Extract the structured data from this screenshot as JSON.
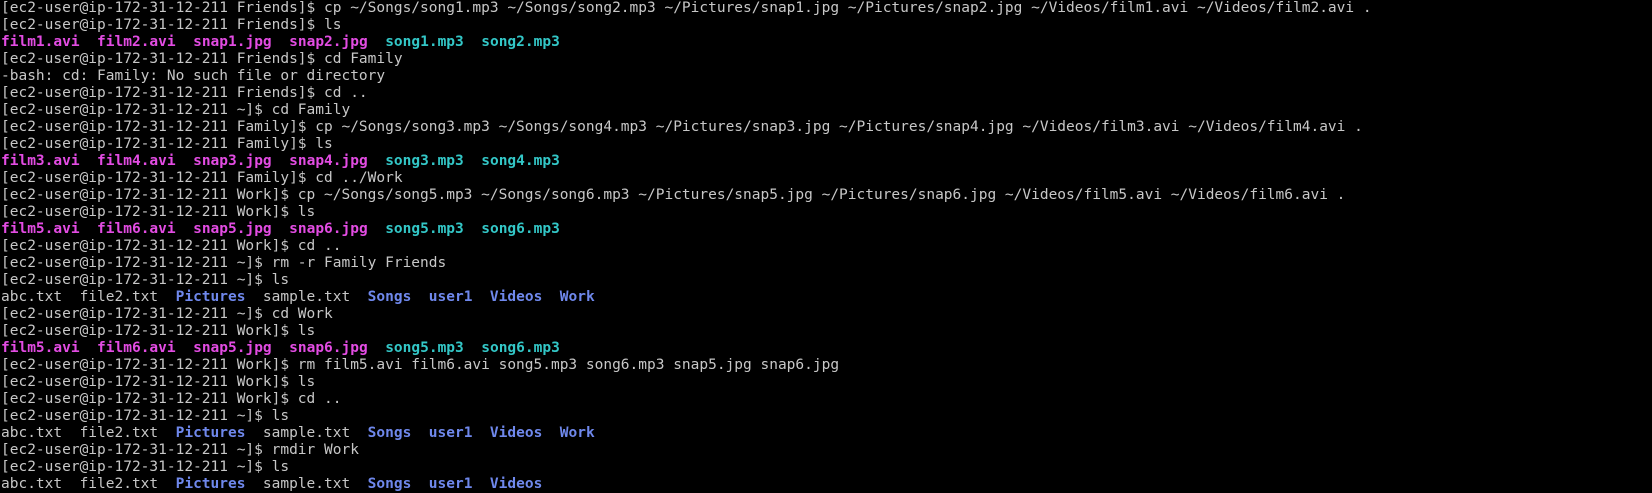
{
  "terminal": {
    "lines": [
      [
        {
          "t": "text",
          "v": "[ec2-user@ip-172-31-12-211 Friends]$ cp ~/Songs/song1.mp3 ~/Songs/song2.mp3 ~/Pictures/snap1.jpg ~/Pictures/snap2.jpg ~/Videos/film1.avi ~/Videos/film2.avi ."
        }
      ],
      [
        {
          "t": "text",
          "v": "[ec2-user@ip-172-31-12-211 Friends]$ ls"
        }
      ],
      [
        {
          "t": "media",
          "v": "film1.avi"
        },
        {
          "t": "text",
          "v": "  "
        },
        {
          "t": "media",
          "v": "film2.avi"
        },
        {
          "t": "text",
          "v": "  "
        },
        {
          "t": "media",
          "v": "snap1.jpg"
        },
        {
          "t": "text",
          "v": "  "
        },
        {
          "t": "media",
          "v": "snap2.jpg"
        },
        {
          "t": "text",
          "v": "  "
        },
        {
          "t": "audio",
          "v": "song1.mp3"
        },
        {
          "t": "text",
          "v": "  "
        },
        {
          "t": "audio",
          "v": "song2.mp3"
        }
      ],
      [
        {
          "t": "text",
          "v": "[ec2-user@ip-172-31-12-211 Friends]$ cd Family"
        }
      ],
      [
        {
          "t": "text",
          "v": "-bash: cd: Family: No such file or directory"
        }
      ],
      [
        {
          "t": "text",
          "v": "[ec2-user@ip-172-31-12-211 Friends]$ cd .."
        }
      ],
      [
        {
          "t": "text",
          "v": "[ec2-user@ip-172-31-12-211 ~]$ cd Family"
        }
      ],
      [
        {
          "t": "text",
          "v": "[ec2-user@ip-172-31-12-211 Family]$ cp ~/Songs/song3.mp3 ~/Songs/song4.mp3 ~/Pictures/snap3.jpg ~/Pictures/snap4.jpg ~/Videos/film3.avi ~/Videos/film4.avi ."
        }
      ],
      [
        {
          "t": "text",
          "v": "[ec2-user@ip-172-31-12-211 Family]$ ls"
        }
      ],
      [
        {
          "t": "media",
          "v": "film3.avi"
        },
        {
          "t": "text",
          "v": "  "
        },
        {
          "t": "media",
          "v": "film4.avi"
        },
        {
          "t": "text",
          "v": "  "
        },
        {
          "t": "media",
          "v": "snap3.jpg"
        },
        {
          "t": "text",
          "v": "  "
        },
        {
          "t": "media",
          "v": "snap4.jpg"
        },
        {
          "t": "text",
          "v": "  "
        },
        {
          "t": "audio",
          "v": "song3.mp3"
        },
        {
          "t": "text",
          "v": "  "
        },
        {
          "t": "audio",
          "v": "song4.mp3"
        }
      ],
      [
        {
          "t": "text",
          "v": "[ec2-user@ip-172-31-12-211 Family]$ cd ../Work"
        }
      ],
      [
        {
          "t": "text",
          "v": "[ec2-user@ip-172-31-12-211 Work]$ cp ~/Songs/song5.mp3 ~/Songs/song6.mp3 ~/Pictures/snap5.jpg ~/Pictures/snap6.jpg ~/Videos/film5.avi ~/Videos/film6.avi ."
        }
      ],
      [
        {
          "t": "text",
          "v": "[ec2-user@ip-172-31-12-211 Work]$ ls"
        }
      ],
      [
        {
          "t": "media",
          "v": "film5.avi"
        },
        {
          "t": "text",
          "v": "  "
        },
        {
          "t": "media",
          "v": "film6.avi"
        },
        {
          "t": "text",
          "v": "  "
        },
        {
          "t": "media",
          "v": "snap5.jpg"
        },
        {
          "t": "text",
          "v": "  "
        },
        {
          "t": "media",
          "v": "snap6.jpg"
        },
        {
          "t": "text",
          "v": "  "
        },
        {
          "t": "audio",
          "v": "song5.mp3"
        },
        {
          "t": "text",
          "v": "  "
        },
        {
          "t": "audio",
          "v": "song6.mp3"
        }
      ],
      [
        {
          "t": "text",
          "v": "[ec2-user@ip-172-31-12-211 Work]$ cd .."
        }
      ],
      [
        {
          "t": "text",
          "v": "[ec2-user@ip-172-31-12-211 ~]$ rm -r Family Friends"
        }
      ],
      [
        {
          "t": "text",
          "v": "[ec2-user@ip-172-31-12-211 ~]$ ls"
        }
      ],
      [
        {
          "t": "text",
          "v": "abc.txt  file2.txt  "
        },
        {
          "t": "dir",
          "v": "Pictures"
        },
        {
          "t": "text",
          "v": "  sample.txt  "
        },
        {
          "t": "dir",
          "v": "Songs"
        },
        {
          "t": "text",
          "v": "  "
        },
        {
          "t": "dir",
          "v": "user1"
        },
        {
          "t": "text",
          "v": "  "
        },
        {
          "t": "dir",
          "v": "Videos"
        },
        {
          "t": "text",
          "v": "  "
        },
        {
          "t": "dir",
          "v": "Work"
        }
      ],
      [
        {
          "t": "text",
          "v": "[ec2-user@ip-172-31-12-211 ~]$ cd Work"
        }
      ],
      [
        {
          "t": "text",
          "v": "[ec2-user@ip-172-31-12-211 Work]$ ls"
        }
      ],
      [
        {
          "t": "media",
          "v": "film5.avi"
        },
        {
          "t": "text",
          "v": "  "
        },
        {
          "t": "media",
          "v": "film6.avi"
        },
        {
          "t": "text",
          "v": "  "
        },
        {
          "t": "media",
          "v": "snap5.jpg"
        },
        {
          "t": "text",
          "v": "  "
        },
        {
          "t": "media",
          "v": "snap6.jpg"
        },
        {
          "t": "text",
          "v": "  "
        },
        {
          "t": "audio",
          "v": "song5.mp3"
        },
        {
          "t": "text",
          "v": "  "
        },
        {
          "t": "audio",
          "v": "song6.mp3"
        }
      ],
      [
        {
          "t": "text",
          "v": "[ec2-user@ip-172-31-12-211 Work]$ rm film5.avi film6.avi song5.mp3 song6.mp3 snap5.jpg snap6.jpg"
        }
      ],
      [
        {
          "t": "text",
          "v": "[ec2-user@ip-172-31-12-211 Work]$ ls"
        }
      ],
      [
        {
          "t": "text",
          "v": "[ec2-user@ip-172-31-12-211 Work]$ cd .."
        }
      ],
      [
        {
          "t": "text",
          "v": "[ec2-user@ip-172-31-12-211 ~]$ ls"
        }
      ],
      [
        {
          "t": "text",
          "v": "abc.txt  file2.txt  "
        },
        {
          "t": "dir",
          "v": "Pictures"
        },
        {
          "t": "text",
          "v": "  sample.txt  "
        },
        {
          "t": "dir",
          "v": "Songs"
        },
        {
          "t": "text",
          "v": "  "
        },
        {
          "t": "dir",
          "v": "user1"
        },
        {
          "t": "text",
          "v": "  "
        },
        {
          "t": "dir",
          "v": "Videos"
        },
        {
          "t": "text",
          "v": "  "
        },
        {
          "t": "dir",
          "v": "Work"
        }
      ],
      [
        {
          "t": "text",
          "v": "[ec2-user@ip-172-31-12-211 ~]$ rmdir Work"
        }
      ],
      [
        {
          "t": "text",
          "v": "[ec2-user@ip-172-31-12-211 ~]$ ls"
        }
      ],
      [
        {
          "t": "text",
          "v": "abc.txt  file2.txt  "
        },
        {
          "t": "dir",
          "v": "Pictures"
        },
        {
          "t": "text",
          "v": "  sample.txt  "
        },
        {
          "t": "dir",
          "v": "Songs"
        },
        {
          "t": "text",
          "v": "  "
        },
        {
          "t": "dir",
          "v": "user1"
        },
        {
          "t": "text",
          "v": "  "
        },
        {
          "t": "dir",
          "v": "Videos"
        }
      ]
    ]
  },
  "colors": {
    "background": "#000000",
    "text": "#c7c7c7",
    "media_file": "#e34ce3",
    "audio_file": "#33c7c7",
    "directory": "#6f88ec"
  }
}
